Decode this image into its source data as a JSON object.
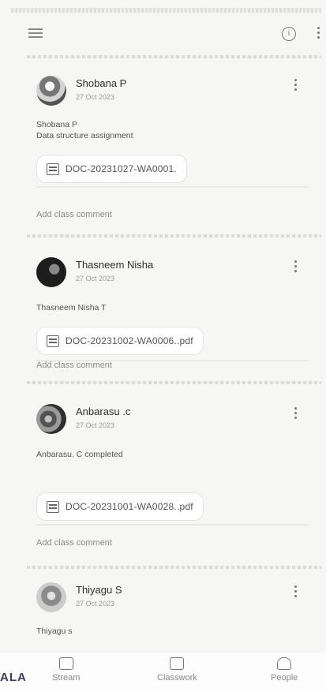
{
  "appbar": {
    "menu_icon": "menu-icon",
    "info_icon": "info-icon",
    "info_glyph": "i",
    "overflow_icon": "more-vert-icon"
  },
  "posts": [
    {
      "author": "Shobana P",
      "date": "27 Oct 2023",
      "lines": [
        "Shobana P",
        "Data structure assignment"
      ],
      "attachment": "DOC-20231027-WA0001.",
      "add_comment": "Add class comment"
    },
    {
      "author": "Thasneem Nisha",
      "date": "27 Oct 2023",
      "lines": [
        "Thasneem Nisha T"
      ],
      "attachment": "DOC-20231002-WA0006..pdf",
      "add_comment": "Add class comment"
    },
    {
      "author": "Anbarasu .c",
      "date": "27 Oct 2023",
      "lines": [
        "Anbarasu. C completed"
      ],
      "attachment": "DOC-20231001-WA0028..pdf",
      "add_comment": "Add class comment"
    },
    {
      "author": "Thiyagu S",
      "date": "27 Oct 2023",
      "lines": [
        "Thiyagu s"
      ]
    }
  ],
  "nav": {
    "stream": "Stream",
    "classwork": "Classwork",
    "people": "People"
  },
  "brand": "ALA"
}
